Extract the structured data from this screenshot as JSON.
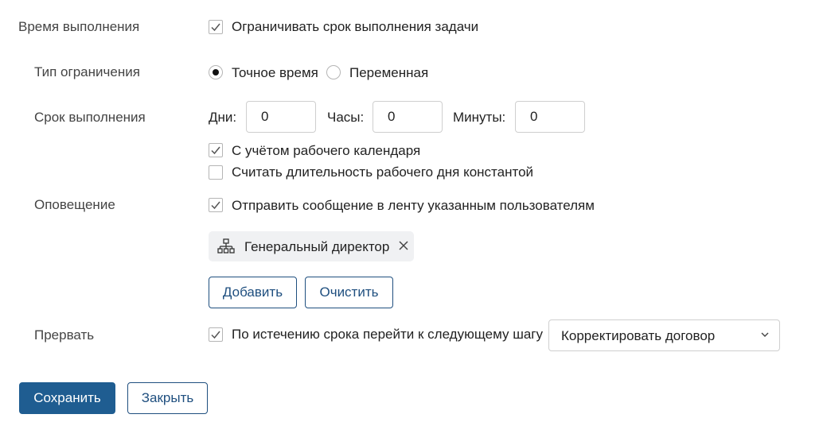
{
  "execution_time": {
    "label": "Время выполнения",
    "limit_checkbox_label": "Ограничивать срок выполнения задачи"
  },
  "limit_type": {
    "label": "Тип ограничения",
    "option_exact": "Точное время",
    "option_variable": "Переменная"
  },
  "deadline": {
    "label": "Срок выполнения",
    "days_label": "Дни:",
    "days_value": "0",
    "hours_label": "Часы:",
    "hours_value": "0",
    "minutes_label": "Минуты:",
    "minutes_value": "0",
    "calendar_checkbox_label": "С учётом рабочего календаря",
    "constant_day_checkbox_label": "Считать длительность рабочего дня константой"
  },
  "notification": {
    "label": "Оповещение",
    "send_checkbox_label": "Отправить сообщение в ленту указанным пользователям",
    "recipient": "Генеральный директор",
    "recipient_icon": "org-structure-icon",
    "add_button": "Добавить",
    "clear_button": "Очистить"
  },
  "interrupt": {
    "label": "Прервать",
    "next_step_checkbox_label": "По истечению срока перейти к следующему шагу",
    "next_step_value": "Корректировать договор"
  },
  "footer": {
    "save_button": "Сохранить",
    "close_button": "Закрыть"
  },
  "colors": {
    "primary": "#1f5d91",
    "outline_button": "#1f4f7f",
    "chip_bg": "#f0f1f3"
  }
}
